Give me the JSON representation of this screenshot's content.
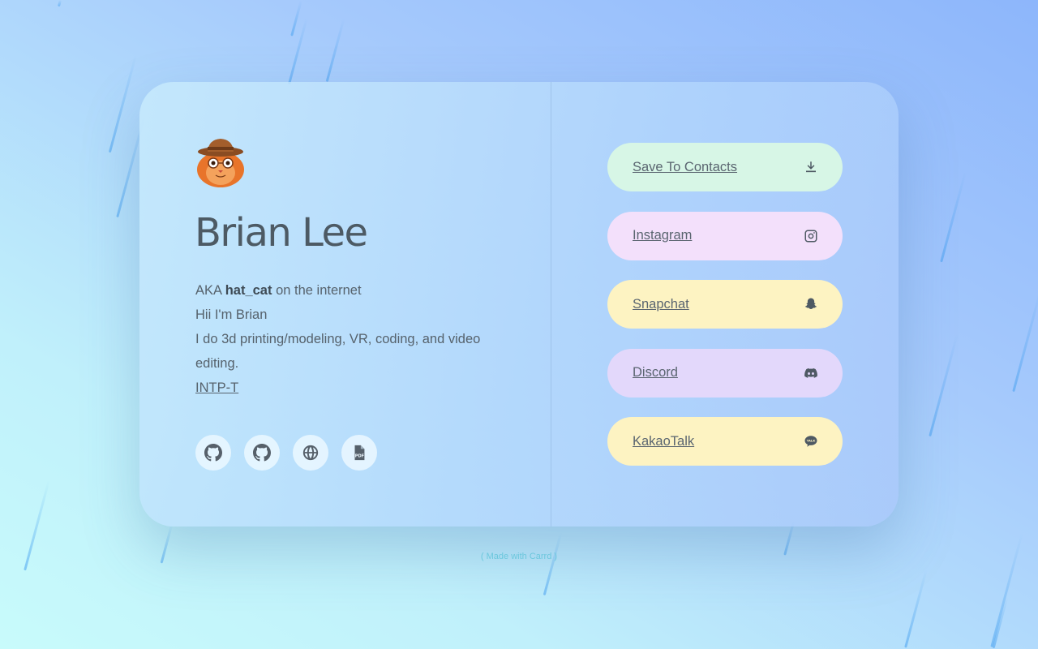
{
  "profile": {
    "name": "Brian Lee",
    "bio": {
      "aka_prefix": "AKA ",
      "handle": "hat_cat",
      "aka_suffix": " on the internet",
      "line2": "Hii I'm Brian",
      "line3": "I do 3d printing/modeling, VR, coding, and video editing.",
      "personality_link": "INTP-T"
    },
    "avatar_icon": "cat-with-hat-avatar"
  },
  "social_icons": [
    {
      "name": "github-icon"
    },
    {
      "name": "github-icon"
    },
    {
      "name": "globe-icon"
    },
    {
      "name": "pdf-file-icon"
    }
  ],
  "links": [
    {
      "label": "Save To Contacts",
      "icon": "download-icon",
      "color": "#d7f6e6"
    },
    {
      "label": "Instagram",
      "icon": "instagram-icon",
      "color": "#f3e0fb"
    },
    {
      "label": "Snapchat",
      "icon": "snapchat-icon",
      "color": "#fdf3c2"
    },
    {
      "label": "Discord",
      "icon": "discord-icon",
      "color": "#e3d8fb"
    },
    {
      "label": "KakaoTalk",
      "icon": "kakaotalk-icon",
      "color": "#fdf3c2"
    }
  ],
  "footer": {
    "credit": "( Made with Carrd )"
  }
}
